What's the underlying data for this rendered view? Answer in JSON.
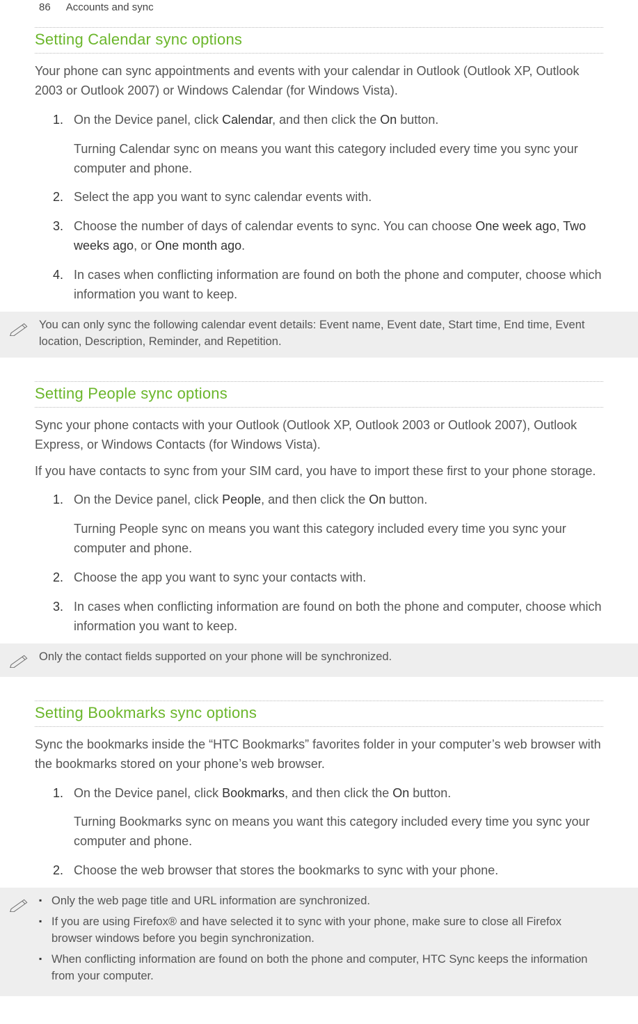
{
  "header": {
    "page_number": "86",
    "chapter": "Accounts and sync"
  },
  "sections": {
    "calendar": {
      "title": "Setting Calendar sync options",
      "intro": "Your phone can sync appointments and events with your calendar in Outlook (Outlook XP, Outlook 2003 or Outlook 2007) or Windows Calendar (for Windows Vista).",
      "steps": [
        {
          "num": "1.",
          "text_pre": "On the Device panel, click ",
          "b1": "Calendar",
          "text_mid": ", and then click the ",
          "b2": "On",
          "text_post": " button.",
          "sub": "Turning Calendar sync on means you want this category included every time you sync your computer and phone."
        },
        {
          "num": "2.",
          "text": "Select the app you want to sync calendar events with."
        },
        {
          "num": "3.",
          "text_pre": "Choose the number of days of calendar events to sync. You can choose ",
          "b1": "One week ago",
          "text_mid1": ", ",
          "b2": "Two weeks ago",
          "text_mid2": ", or ",
          "b3": "One month ago",
          "text_post": "."
        },
        {
          "num": "4.",
          "text": "In cases when conflicting information are found on both the phone and computer, choose which information you want to keep."
        }
      ],
      "note": "You can only sync the following calendar event details: Event name, Event date, Start time, End time, Event location, Description, Reminder, and Repetition."
    },
    "people": {
      "title": "Setting People sync options",
      "intro1": "Sync your phone contacts with your Outlook (Outlook XP, Outlook 2003 or Outlook 2007), Outlook Express, or Windows Contacts (for Windows Vista).",
      "intro2": "If you have contacts to sync from your SIM card, you have to import these first to your phone storage.",
      "steps": [
        {
          "num": "1.",
          "text_pre": "On the Device panel, click ",
          "b1": "People",
          "text_mid": ", and then click the ",
          "b2": "On",
          "text_post": " button.",
          "sub": "Turning People sync on means you want this category included every time you sync your computer and phone."
        },
        {
          "num": "2.",
          "text": "Choose the app you want to sync your contacts with."
        },
        {
          "num": "3.",
          "text": "In cases when conflicting information are found on both the phone and computer, choose which information you want to keep."
        }
      ],
      "note": "Only the contact fields supported on your phone will be synchronized."
    },
    "bookmarks": {
      "title": "Setting Bookmarks sync options",
      "intro": "Sync the bookmarks inside the “HTC Bookmarks” favorites folder in your computer’s web browser with the bookmarks stored on your phone’s web browser.",
      "steps": [
        {
          "num": "1.",
          "text_pre": "On the Device panel, click ",
          "b1": "Bookmarks",
          "text_mid": ", and then click the ",
          "b2": "On",
          "text_post": " button.",
          "sub": "Turning Bookmarks sync on means you want this category included every time you sync your computer and phone."
        },
        {
          "num": "2.",
          "text": "Choose the web browser that stores the bookmarks to sync with your phone."
        }
      ],
      "note_bullets": [
        "Only the web page title and URL information are synchronized.",
        "If you are using Firefox® and have selected it to sync with your phone, make sure to close all Firefox browser windows before you begin synchronization.",
        "When conflicting information are found on both the phone and computer, HTC Sync keeps the information from your computer."
      ]
    }
  }
}
